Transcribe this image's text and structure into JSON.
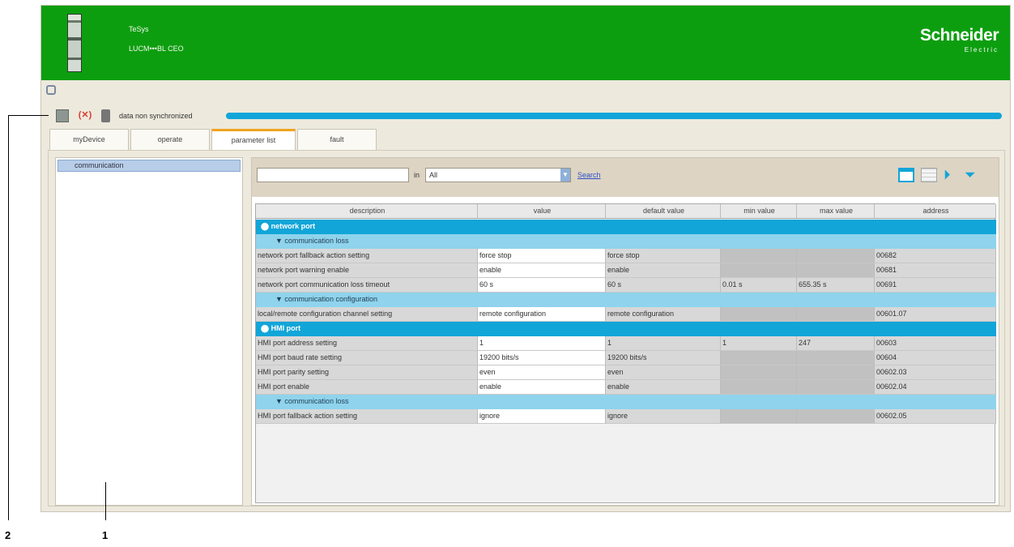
{
  "header": {
    "device_name": "TeSys",
    "device_ref": "LUCM•••BL CEO",
    "brand": "Schneider",
    "brand_sub": "Electric",
    "colors": {
      "header_bg": "#0d9e10",
      "accent": "#12a5d8"
    }
  },
  "sync": {
    "status_label": "data non synchronized",
    "icons": [
      "connect-icon",
      "disconnect-icon",
      "delete-icon"
    ]
  },
  "tabs": [
    {
      "label": "myDevice"
    },
    {
      "label": "operate"
    },
    {
      "label": "parameter list",
      "active": true
    },
    {
      "label": "fault"
    }
  ],
  "tree": {
    "items": [
      {
        "label": "communication",
        "selected": true
      }
    ]
  },
  "filter": {
    "search_value": "",
    "in_label": "in",
    "scope_value": "All",
    "search_link": "Search"
  },
  "table": {
    "columns": [
      "description",
      "value",
      "default value",
      "min value",
      "max value",
      "address"
    ],
    "groups": [
      {
        "label": "network port"
      },
      {
        "label": "HMI port"
      }
    ],
    "subgroups": [
      {
        "label": "communication loss"
      },
      {
        "label": "communication configuration"
      },
      {
        "label": "communication loss"
      }
    ],
    "rows": [
      {
        "desc": "network port fallback action setting",
        "value": "force stop",
        "default": "force stop",
        "min": "",
        "max": "",
        "addr": "00682"
      },
      {
        "desc": "network port warning enable",
        "value": "enable",
        "default": "enable",
        "min": "",
        "max": "",
        "addr": "00681"
      },
      {
        "desc": "network port communication loss timeout",
        "value": "60 s",
        "default": "60 s",
        "min": "0.01 s",
        "max": "655.35 s",
        "addr": "00691"
      },
      {
        "desc": "local/remote configuration channel setting",
        "value": "remote configuration",
        "default": "remote configuration",
        "min": "",
        "max": "",
        "addr": "00601.07"
      },
      {
        "desc": "HMI port address setting",
        "value": "1",
        "default": "1",
        "min": "1",
        "max": "247",
        "addr": "00603"
      },
      {
        "desc": "HMI port baud rate setting",
        "value": "19200 bits/s",
        "default": "19200 bits/s",
        "min": "",
        "max": "",
        "addr": "00604"
      },
      {
        "desc": "HMI port parity setting",
        "value": "even",
        "default": "even",
        "min": "",
        "max": "",
        "addr": "00602.03"
      },
      {
        "desc": "HMI port enable",
        "value": "enable",
        "default": "enable",
        "min": "",
        "max": "",
        "addr": "00602.04"
      },
      {
        "desc": "HMI port fallback action setting",
        "value": "ignore",
        "default": "ignore",
        "min": "",
        "max": "",
        "addr": "00602.05"
      }
    ]
  },
  "callouts": {
    "label_1": "1",
    "label_2": "2"
  }
}
